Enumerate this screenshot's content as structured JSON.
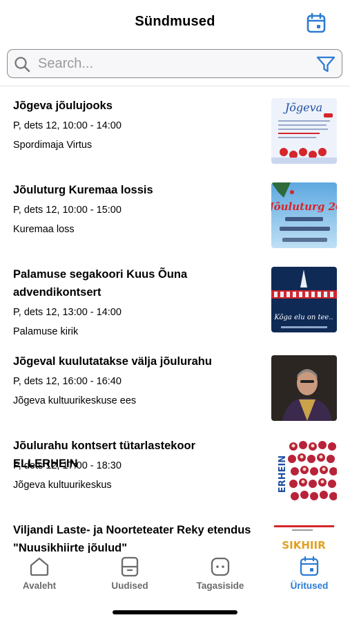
{
  "header": {
    "title": "Sündmused",
    "calendar_icon": "calendar-icon"
  },
  "search": {
    "placeholder": "Search...",
    "search_icon": "search-icon",
    "filter_icon": "filter-icon"
  },
  "events": [
    {
      "title": "Jõgeva jõulujooks",
      "time": "P, dets 12, 10:00 - 14:00",
      "place": "Spordimaja Virtus",
      "thumb_text": "Jõgeva"
    },
    {
      "title": "Jõuluturg Kuremaa lossis",
      "time": "P, dets 12, 10:00 - 15:00",
      "place": "Kuremaa loss",
      "thumb_text": "Jõuluturg 20"
    },
    {
      "title": "Palamuse segakoori Kuus Õuna advendikontsert",
      "time": "P, dets 12, 13:00 - 14:00",
      "place": "Palamuse kirik",
      "thumb_text": "Kõga elu on tee.."
    },
    {
      "title": "Jõgeval kuulutatakse välja jõulurahu",
      "time": "P, dets 12, 16:00 - 16:40",
      "place": "Jõgeva kultuurikeskuse ees",
      "thumb_text": ""
    },
    {
      "title": "Jõulurahu kontsert tütarlastekoor ELLERHEIN",
      "time": "P, dets 12, 17:00 - 18:30",
      "place": "Jõgeva kultuurikeskus",
      "thumb_text": "ERHEIN"
    },
    {
      "title": "Viljandi Laste- ja Noorteteater Reky etendus \"Nuusikhiirte jõulud\"",
      "time": "",
      "place": "",
      "thumb_text": "SIKHIIR"
    }
  ],
  "tabbar": {
    "tabs": [
      {
        "label": "Avaleht",
        "icon": "home-icon",
        "active": false
      },
      {
        "label": "Uudised",
        "icon": "news-icon",
        "active": false
      },
      {
        "label": "Tagasiside",
        "icon": "feedback-icon",
        "active": false
      },
      {
        "label": "Üritused",
        "icon": "calendar-icon",
        "active": true
      }
    ]
  },
  "colors": {
    "accent": "#2b7cd3",
    "tab_inactive": "#6b6b6b",
    "divider": "#e3e3e6"
  }
}
